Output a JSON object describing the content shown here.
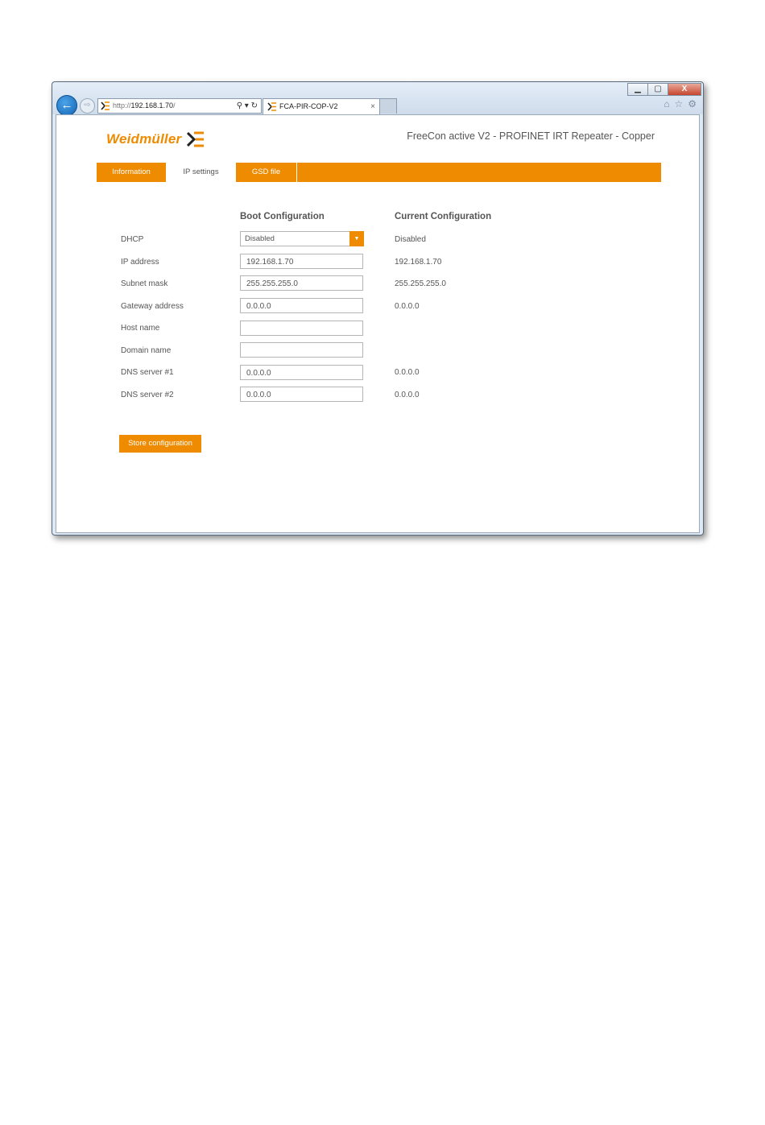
{
  "browser": {
    "url_prefix": "http://",
    "url_host": "192.168.1.70",
    "url_suffix": "/",
    "tab_title": "FCA-PIR-COP-V2",
    "tab_close": "×",
    "window_minimize": "▁",
    "window_maximize": "▢",
    "window_close": "X"
  },
  "header": {
    "logo_text": "Weidmüller",
    "product_title": "FreeCon active V2 - PROFINET IRT Repeater - Copper"
  },
  "nav": {
    "tabs": [
      {
        "label": "Information"
      },
      {
        "label": "IP settings"
      },
      {
        "label": "GSD file"
      }
    ],
    "active": "IP settings"
  },
  "form": {
    "boot_header": "Boot Configuration",
    "current_header": "Current Configuration",
    "rows": [
      {
        "label": "DHCP",
        "boot": "Disabled",
        "current": "Disabled"
      },
      {
        "label": "IP address",
        "boot": "192.168.1.70",
        "current": "192.168.1.70"
      },
      {
        "label": "Subnet mask",
        "boot": "255.255.255.0",
        "current": "255.255.255.0"
      },
      {
        "label": "Gateway address",
        "boot": "0.0.0.0",
        "current": "0.0.0.0"
      },
      {
        "label": "Host name",
        "boot": "",
        "current": ""
      },
      {
        "label": "Domain name",
        "boot": "",
        "current": ""
      },
      {
        "label": "DNS server #1",
        "boot": "0.0.0.0",
        "current": "0.0.0.0"
      },
      {
        "label": "DNS server #2",
        "boot": "0.0.0.0",
        "current": "0.0.0.0"
      }
    ],
    "store_label": "Store configuration"
  },
  "colors": {
    "accent": "#ef8b00",
    "text": "#555555"
  }
}
